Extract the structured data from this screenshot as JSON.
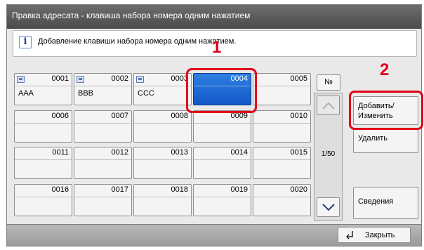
{
  "window": {
    "title": "Правка адресата - клавиша набора номера одним нажатием"
  },
  "info": {
    "icon": "info-icon",
    "text": "Добавление клавиши набора номера одним нажатием."
  },
  "keys": [
    {
      "num": "0001",
      "name": "AAA",
      "has_icon": true
    },
    {
      "num": "0002",
      "name": "BBB",
      "has_icon": true
    },
    {
      "num": "0003",
      "name": "CCC",
      "has_icon": true
    },
    {
      "num": "0004",
      "name": "",
      "has_icon": false,
      "selected": true
    },
    {
      "num": "0005",
      "name": "",
      "has_icon": false
    },
    {
      "num": "0006",
      "name": ""
    },
    {
      "num": "0007",
      "name": ""
    },
    {
      "num": "0008",
      "name": ""
    },
    {
      "num": "0009",
      "name": ""
    },
    {
      "num": "0010",
      "name": ""
    },
    {
      "num": "0011",
      "name": ""
    },
    {
      "num": "0012",
      "name": ""
    },
    {
      "num": "0013",
      "name": ""
    },
    {
      "num": "0014",
      "name": ""
    },
    {
      "num": "0015",
      "name": ""
    },
    {
      "num": "0016",
      "name": ""
    },
    {
      "num": "0017",
      "name": ""
    },
    {
      "num": "0018",
      "name": ""
    },
    {
      "num": "0019",
      "name": ""
    },
    {
      "num": "0020",
      "name": ""
    }
  ],
  "nav": {
    "number_label": "№",
    "page_indicator": "1/50",
    "up_icon": "chevron-up-icon",
    "down_icon": "chevron-down-icon"
  },
  "actions": {
    "add_edit_line1": "Добавить/",
    "add_edit_line2": "Изменить",
    "delete": "Удалить",
    "details": "Сведения"
  },
  "footer": {
    "close": "Закрыть",
    "close_icon": "return-arrow-icon"
  },
  "callouts": {
    "step1": "1",
    "step2": "2"
  },
  "colors": {
    "highlight": "#e2001a",
    "selected": "#1257c9"
  }
}
